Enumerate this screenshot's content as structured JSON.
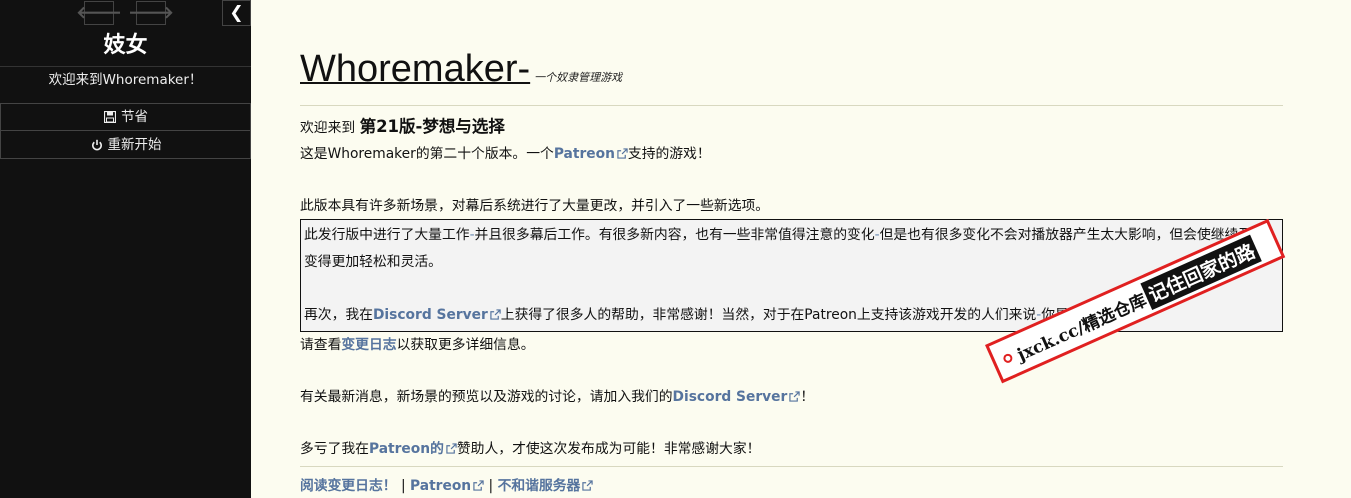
{
  "sidebar": {
    "back_label": "🡐",
    "forward_label": "🡒",
    "collapse_label": "❮",
    "story_title": "妓女",
    "story_subtitle": "欢迎来到Whoremaker！",
    "menu": [
      {
        "icon": "save-icon",
        "label": "节省"
      },
      {
        "icon": "power-icon",
        "label": "重新开始"
      }
    ]
  },
  "passage": {
    "title": "Whoremaker-",
    "tagline": "一个奴隶管理游戏",
    "welcome_prefix": "欢迎来到 ",
    "version_name": "第21版-梦想与选择",
    "intro": {
      "prefix": "这是Whoremaker的第二十个版本。一个",
      "link": "Patreon",
      "suffix": "支持的游戏！"
    },
    "summary": "此版本具有许多新场景，对幕后系统进行了大量更改，并引入了一些新选项。",
    "notice": {
      "para1_a": "此发行版中进行了大量工作",
      "para1_b": "并且很多幕后工作。有很多新内容，也有一些非常值得注意的变化",
      "para1_c": "但是也有很多变化不会对播放器产生太大影响，但会使继续开发变得更加轻松和灵活。",
      "dash": "-",
      "para2_prefix": "再次，我在",
      "para2_link": "Discord Server",
      "para2_mid": "上获得了很多人的帮助，非常感谢！当然，对于在Patreon上支持该游戏开发的人们来说",
      "para2_suffix": "你是最好的！"
    },
    "changelog": {
      "prefix": "请查看",
      "link": "变更日志",
      "suffix": "以获取更多详细信息。"
    },
    "news": {
      "prefix": "有关最新消息，新场景的预览以及游戏的讨论，请加入我们的",
      "link": "Discord Server",
      "suffix": "！"
    },
    "thanks": {
      "prefix": "多亏了我在",
      "link": "Patreon的",
      "suffix": "赞助人，才使这次发布成为可能！非常感谢大家！"
    },
    "footer": {
      "link1": "阅读变更日志！",
      "sep": "|",
      "link2": "Patreon",
      "link3": "不和谐服务器"
    }
  },
  "watermark": {
    "site": "jxck.cc/精选仓库",
    "slogan": "记住回家的路"
  },
  "colors": {
    "sidebar_bg": "#111111",
    "page_bg": "#fcfcf0",
    "link": "#56749e",
    "stamp_red": "#e02020"
  }
}
